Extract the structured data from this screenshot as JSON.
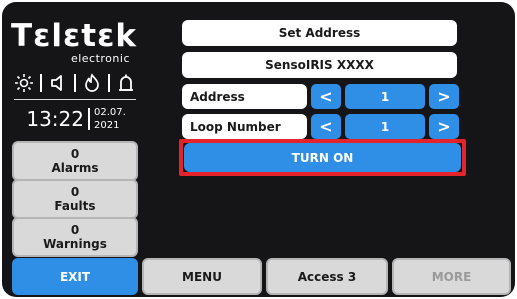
{
  "brand": {
    "name": "Tεlεtεk",
    "sub": "electronic"
  },
  "status": {
    "icons": [
      "sun-icon",
      "speaker-icon",
      "flame-icon",
      "bell-icon"
    ],
    "time": "13:22",
    "date_day_month": "02.07.",
    "date_year": "2021"
  },
  "sidebar": {
    "alarms": {
      "count": "0",
      "label": "Alarms"
    },
    "faults": {
      "count": "0",
      "label": "Faults"
    },
    "warnings": {
      "count": "0",
      "label": "Warnings"
    }
  },
  "panel": {
    "title": "Set Address",
    "device": "SensoIRIS XXXX",
    "address": {
      "label": "Address",
      "value": "1",
      "prev": "<",
      "next": ">"
    },
    "loop": {
      "label": "Loop Number",
      "value": "1",
      "prev": "<",
      "next": ">"
    },
    "turn_on": "TURN ON"
  },
  "bottom": {
    "exit": "EXIT",
    "menu": "MENU",
    "access": "Access 3",
    "more": "MORE"
  },
  "colors": {
    "accent": "#2f8fe6",
    "highlight": "#e3242b",
    "background": "#151517"
  }
}
